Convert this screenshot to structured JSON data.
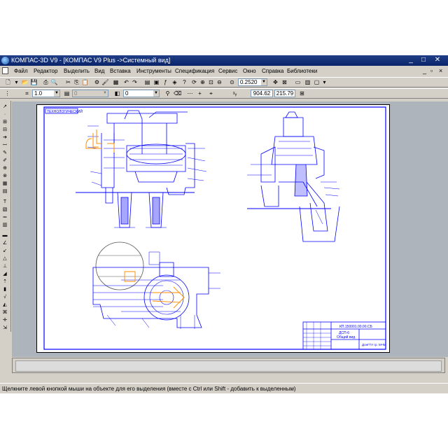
{
  "window": {
    "title": "КОМПАС-3D V9 - [КОМПАС V9 Plus ->Системный вид]"
  },
  "menu": {
    "items": [
      "Файл",
      "Редактор",
      "Выделить",
      "Вид",
      "Вставка",
      "Инструменты",
      "Спецификация",
      "Сервис",
      "Окно",
      "Справка",
      "Библиотеки"
    ]
  },
  "toolbar": {
    "zoom_value": "0.2520",
    "line_style_value": "1.0",
    "layer_value": "0",
    "style_value": "0",
    "coord_x": "904.62",
    "coord_y": "215.79"
  },
  "drawing": {
    "stamp_code": "ТЕХНОЛОГИЧЕСКИЙ",
    "title_doc_code": "КП.150001.00.00.СБ",
    "title_name_line1": "ДСП-6",
    "title_name_line2": "Общий вид",
    "title_org": "ДонГТУ гр. МЧМ"
  },
  "status": {
    "message": "Щелкните левой кнопкой мыши на объекте для его выделения (вместе с Ctrl или Shift - добавить к выделенным)"
  },
  "colors": {
    "title_bar": "#0a246a",
    "drawing_lines": "#0000ff",
    "highlight_lines": "#ff8c00",
    "canvas_bg": "#aeb4bc"
  }
}
